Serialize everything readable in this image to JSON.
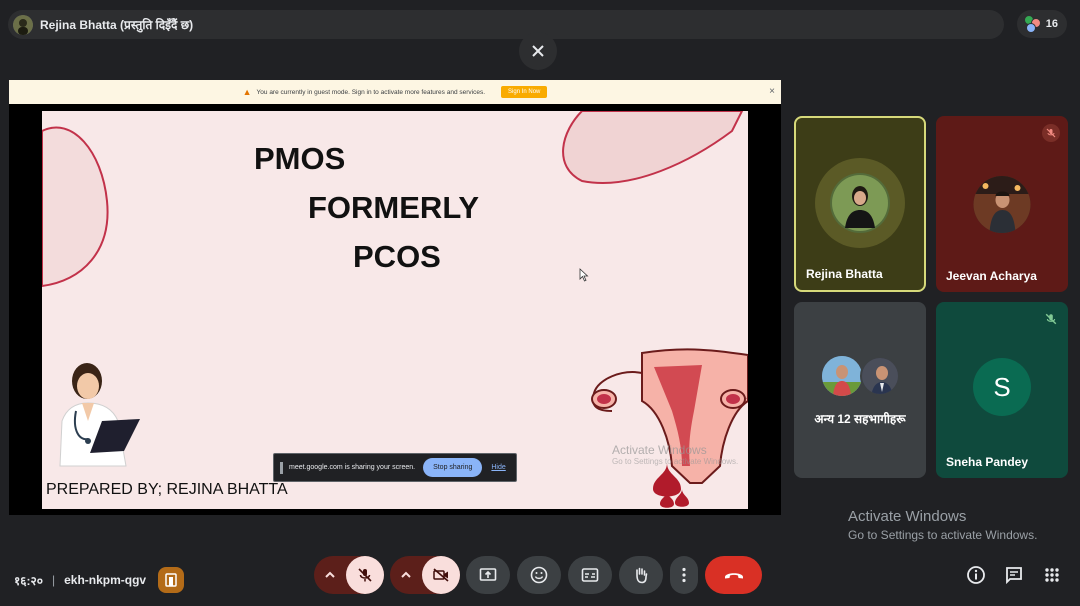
{
  "header": {
    "presenter_title": "Rejina Bhatta (प्रस्तुति दिइँदैं छ)",
    "participant_count": "16"
  },
  "guest_banner": {
    "text": "You are currently in guest mode. Sign in to activate more features and services.",
    "signin_label": "Sign In Now",
    "close_symbol": "×"
  },
  "slide": {
    "line1": "PMOS",
    "line2": "FORMERLY",
    "line3": "PCOS",
    "prepared_by": "PREPARED BY; REJINA BHATTA",
    "watermark_title": "Activate Windows",
    "watermark_sub": "Go to Settings to activate Windows."
  },
  "share_bar": {
    "text": "meet.google.com is sharing your screen.",
    "stop_label": "Stop sharing",
    "hide_label": "Hide"
  },
  "tiles": [
    {
      "name": "Rejina Bhatta",
      "bg": "#3d3d17",
      "border": "#d6d97a",
      "muted": false
    },
    {
      "name": "Jeevan Acharya",
      "bg": "#5e1a17",
      "muted": true
    },
    {
      "label": "अन्य 12 सहभागीहरू",
      "bg": "#3c4043"
    },
    {
      "name": "Sneha Pandey",
      "initial": "S",
      "bg": "#0f4a3d",
      "muted": true
    }
  ],
  "watermark": {
    "title": "Activate Windows",
    "sub": "Go to Settings to activate Windows."
  },
  "meeting": {
    "time": "१६:२०",
    "separator": "|",
    "code": "ekh-nkpm-qgv"
  },
  "colors": {
    "background": "#202124",
    "end_call": "#d93025",
    "off_control": "#f9dedc",
    "accent_blue": "#8ab4f8"
  }
}
